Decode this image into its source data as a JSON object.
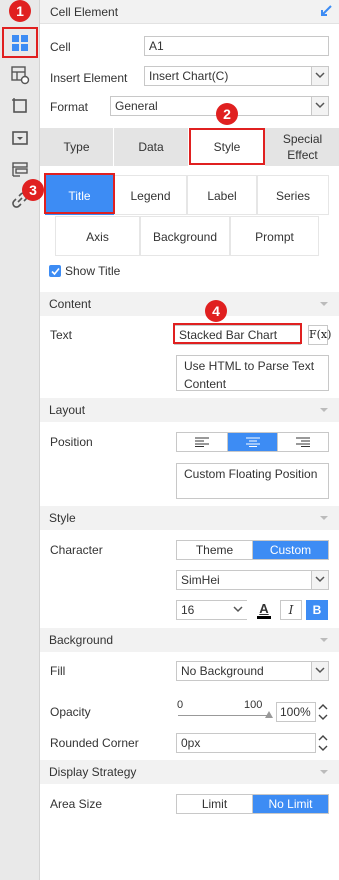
{
  "panel": {
    "title": "Cell Element"
  },
  "cell": {
    "label": "Cell",
    "value": "A1"
  },
  "insert_element": {
    "label": "Insert Element",
    "value": "Insert Chart(C)"
  },
  "format": {
    "label": "Format",
    "value": "General"
  },
  "main_tabs": [
    {
      "label": "Type"
    },
    {
      "label": "Data"
    },
    {
      "label": "Style"
    },
    {
      "label": "Special Effect"
    }
  ],
  "style_tabs_row1": [
    {
      "label": "Title"
    },
    {
      "label": "Legend"
    },
    {
      "label": "Label"
    },
    {
      "label": "Series"
    }
  ],
  "style_tabs_row2": [
    {
      "label": "Axis"
    },
    {
      "label": "Background"
    },
    {
      "label": "Prompt"
    }
  ],
  "show_title": {
    "label": "Show Title",
    "checked": true
  },
  "content_section": {
    "title": "Content",
    "text_label": "Text",
    "text_value": "Stacked Bar Chart",
    "fx_label": "F(x)",
    "html_parse_label": "Use HTML to Parse Text Content"
  },
  "layout_section": {
    "title": "Layout",
    "position_label": "Position",
    "align_selected": "center",
    "custom_floating_label": "Custom Floating Position"
  },
  "style_section": {
    "title": "Style",
    "character_label": "Character",
    "theme_label": "Theme",
    "custom_label": "Custom",
    "selected": "Custom",
    "font_family": "SimHei",
    "font_size": "16",
    "bold_label": "B",
    "italic_label": "I",
    "color_label": "A"
  },
  "background_section": {
    "title": "Background",
    "fill_label": "Fill",
    "fill_value": "No Background",
    "opacity_label": "Opacity",
    "slider_min": "0",
    "slider_max": "100",
    "opacity_value": "100%",
    "opacity_level": 1.0,
    "rounded_label": "Rounded Corner",
    "rounded_value": "0px"
  },
  "display_section": {
    "title": "Display Strategy",
    "area_size_label": "Area Size",
    "limit_label": "Limit",
    "no_limit_label": "No Limit",
    "selected": "No Limit"
  },
  "annotations": [
    "1",
    "2",
    "3",
    "4"
  ],
  "colors": {
    "accent": "#3d8cf4",
    "annotation": "#e02020"
  }
}
